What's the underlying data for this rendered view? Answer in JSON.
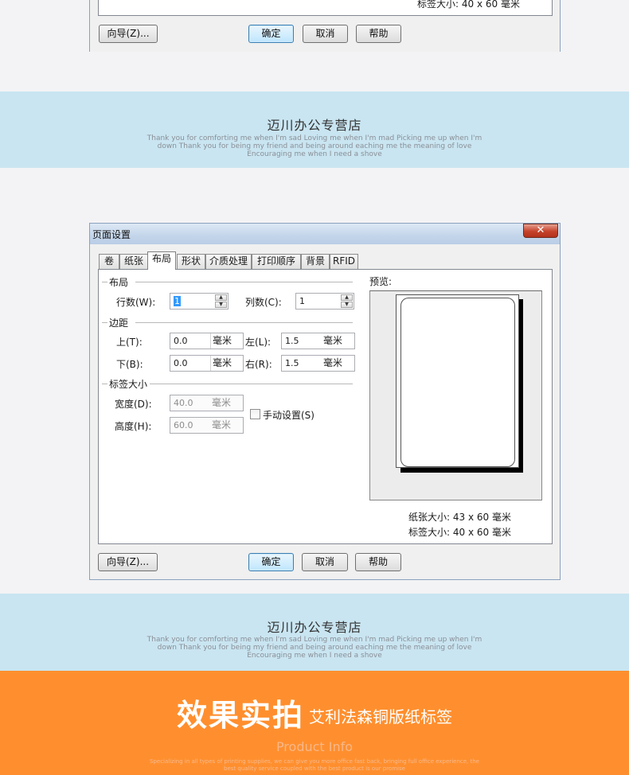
{
  "top_dialog": {
    "label_size_text": "标签大小:  40 x 60 毫米",
    "buttons": {
      "wizard": "向导(Z)...",
      "ok": "确定",
      "cancel": "取消",
      "help": "帮助"
    }
  },
  "banner": {
    "shop_name": "迈川办公专营店",
    "tagline": "Thank you for comforting me when I'm sad Loving me when I'm mad Picking me up when I'm down Thank you for being my friend and being around eaching me the meaning of love Encouraging me when I need a shove"
  },
  "dialog": {
    "title": "页面设置",
    "close_glyph": "✕",
    "tabs": [
      "卷",
      "纸张",
      "布局",
      "形状",
      "介质处理",
      "打印顺序",
      "背景",
      "RFID"
    ],
    "active_tab": "布局",
    "layout_group": {
      "title": "布局",
      "rows_label": "行数(W):",
      "rows_value": "1",
      "cols_label": "列数(C):",
      "cols_value": "1"
    },
    "margin_group": {
      "title": "边距",
      "top_label": "上(T):",
      "top_value": "0.0",
      "left_label": "左(L):",
      "left_value": "1.5",
      "bottom_label": "下(B):",
      "bottom_value": "0.0",
      "right_label": "右(R):",
      "right_value": "1.5",
      "unit": "毫米"
    },
    "label_size_group": {
      "title": "标签大小",
      "width_label": "宽度(D):",
      "width_value": "40.0",
      "height_label": "高度(H):",
      "height_value": "60.0",
      "unit": "毫米",
      "manual_label": "手动设置(S)",
      "manual_checked": false
    },
    "preview": {
      "title": "预览:",
      "paper_size": "纸张大小:  43 x 60 毫米",
      "label_size": "标签大小:  40 x 60 毫米"
    },
    "buttons": {
      "wizard": "向导(Z)...",
      "ok": "确定",
      "cancel": "取消",
      "help": "帮助"
    }
  },
  "footer": {
    "headline": "效果实拍",
    "subtitle": "艾利法森铜版纸标签",
    "product_info": "Product Info",
    "fine_print": "Specializing in all types of printing supplies, we can give you more office fast back, bringing full office experience, the best quality service coupled with the best product is our promise"
  },
  "colors": {
    "banner_bg": "#c9e5f1",
    "footer_bg": "#ff8f2e",
    "dialog_bg": "#f0f0f0"
  }
}
